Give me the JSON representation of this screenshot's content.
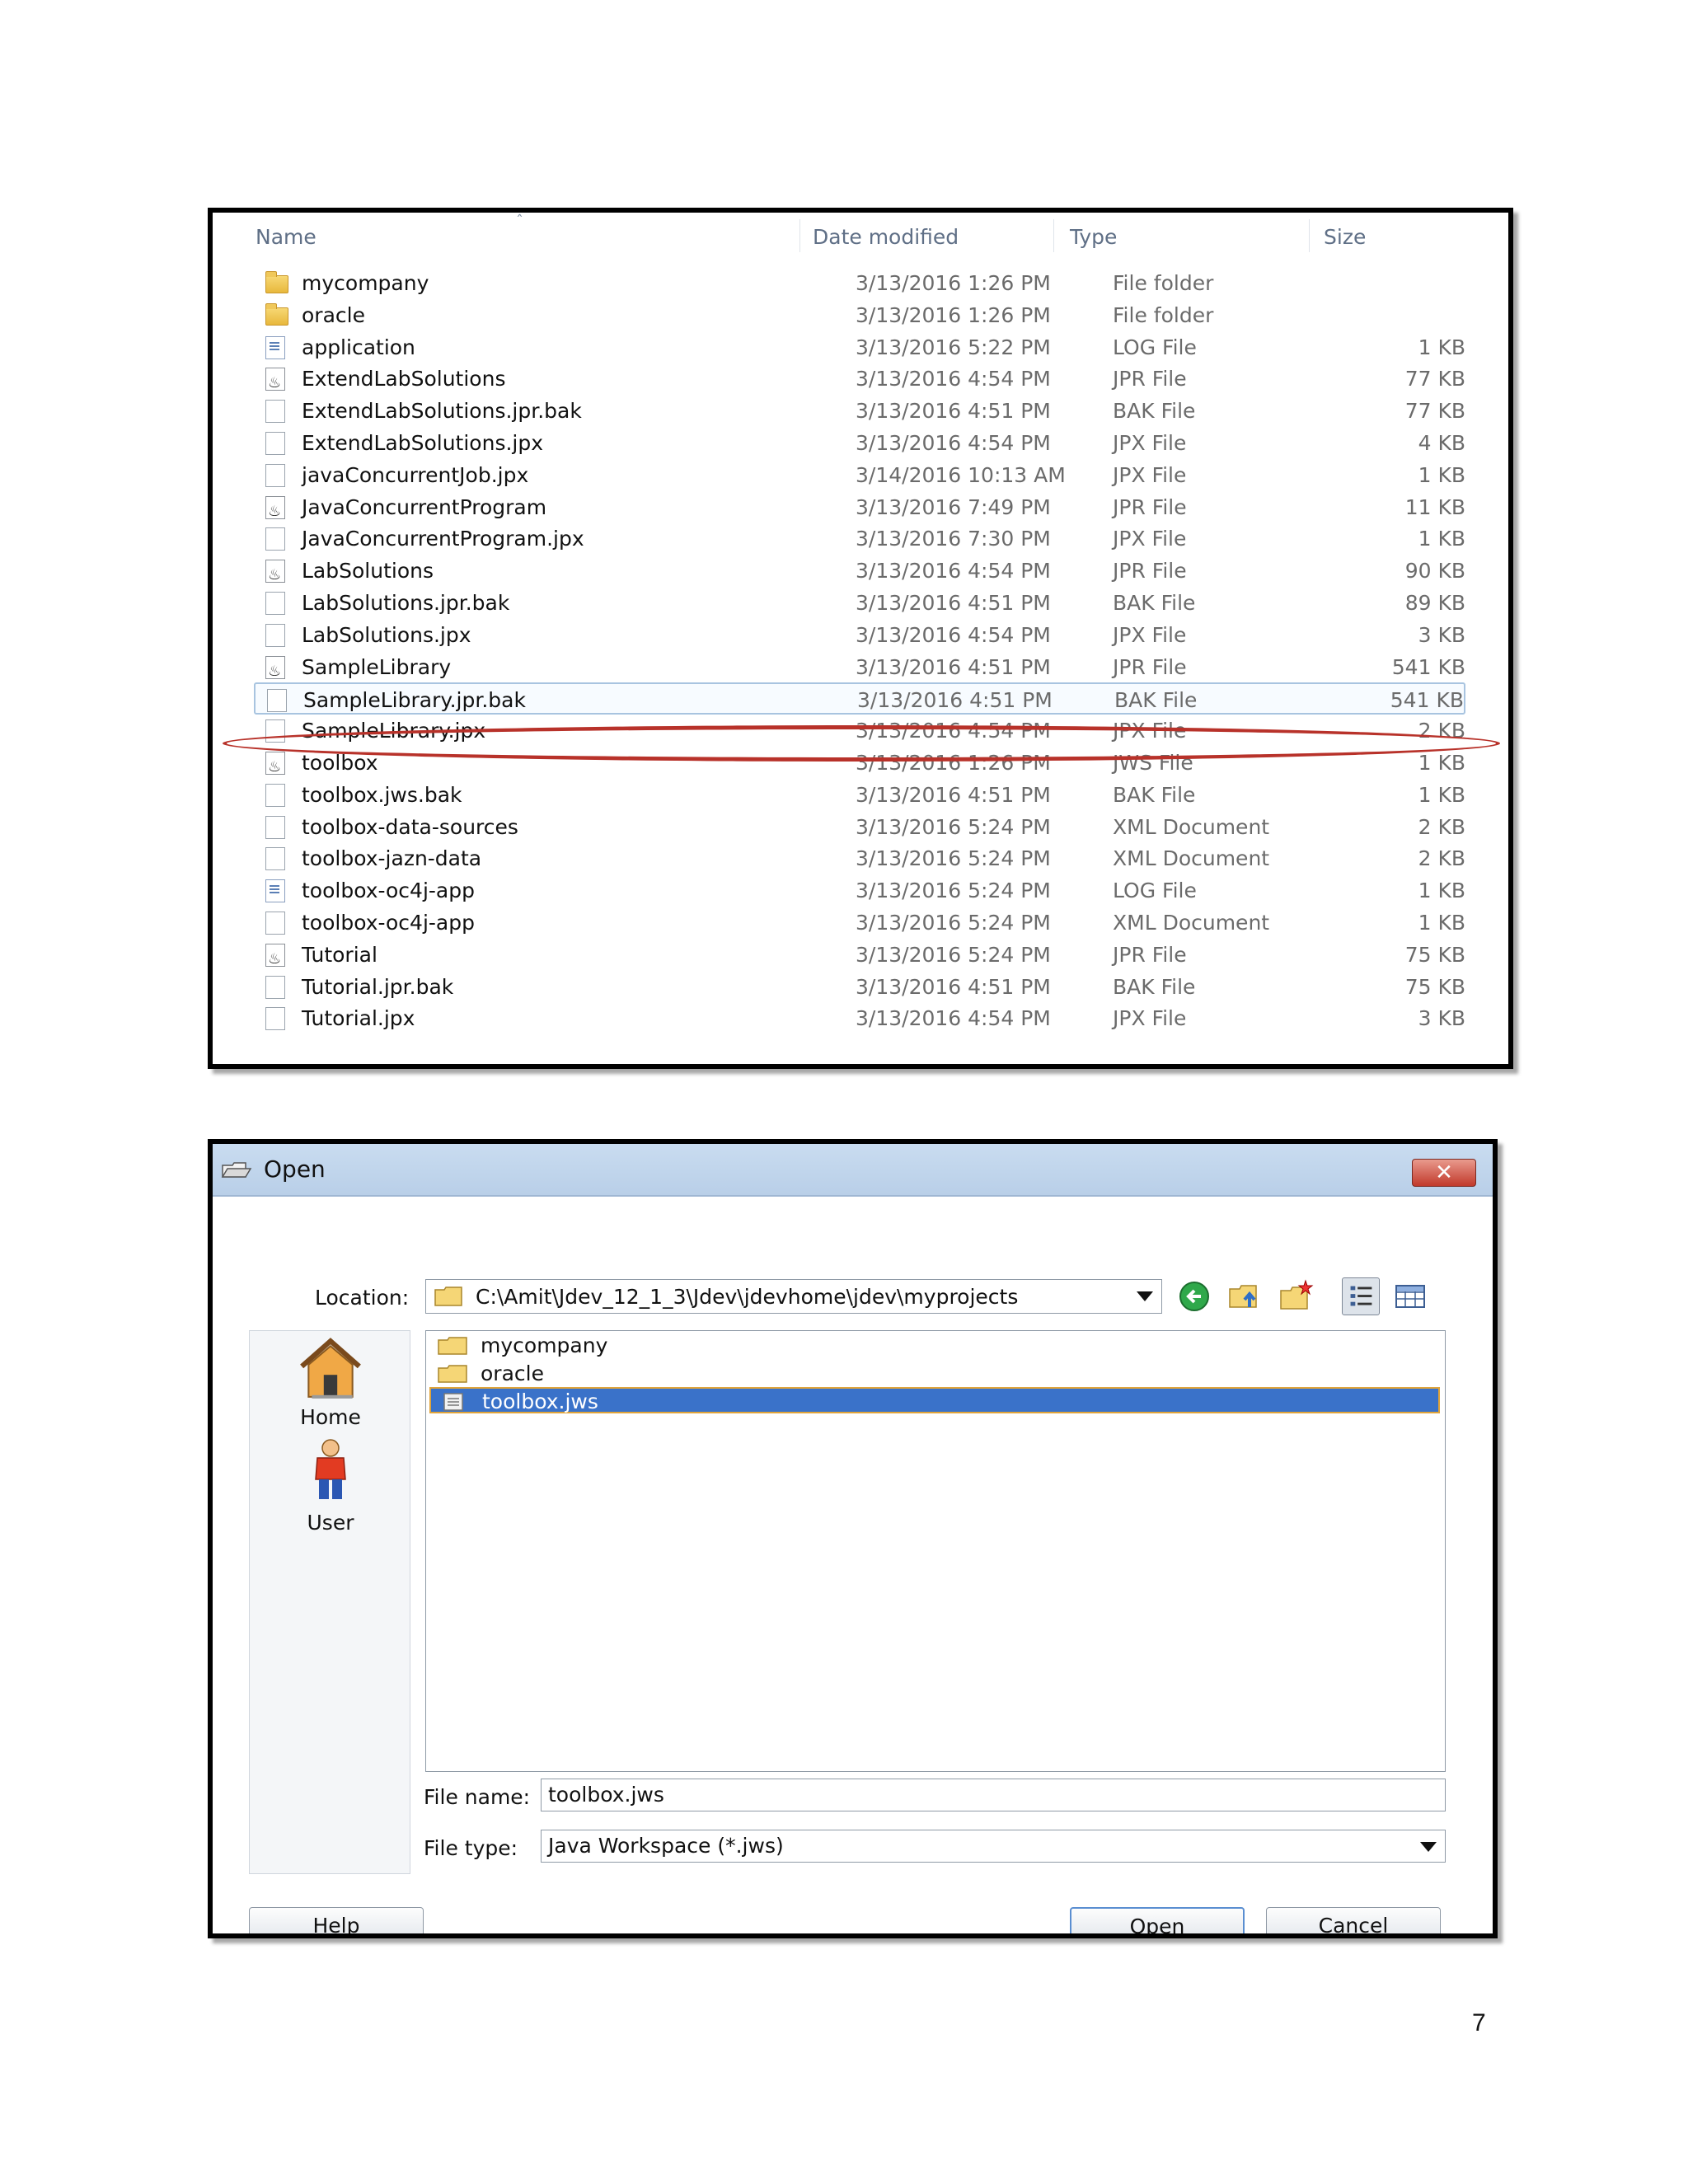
{
  "explorer": {
    "columns": {
      "name": "Name",
      "date": "Date modified",
      "type": "Type",
      "size": "Size"
    },
    "rows": [
      {
        "icon": "folder-icon",
        "name": "mycompany",
        "date": "3/13/2016 1:26 PM",
        "type": "File folder",
        "size": ""
      },
      {
        "icon": "folder-icon",
        "name": "oracle",
        "date": "3/13/2016 1:26 PM",
        "type": "File folder",
        "size": ""
      },
      {
        "icon": "log-file-icon",
        "name": "application",
        "date": "3/13/2016 5:22 PM",
        "type": "LOG File",
        "size": "1 KB"
      },
      {
        "icon": "jdev-project-icon",
        "name": "ExtendLabSolutions",
        "date": "3/13/2016 4:54 PM",
        "type": "JPR File",
        "size": "77 KB"
      },
      {
        "icon": "file-icon",
        "name": "ExtendLabSolutions.jpr.bak",
        "date": "3/13/2016 4:51 PM",
        "type": "BAK File",
        "size": "77 KB"
      },
      {
        "icon": "file-icon",
        "name": "ExtendLabSolutions.jpx",
        "date": "3/13/2016 4:54 PM",
        "type": "JPX File",
        "size": "4 KB"
      },
      {
        "icon": "file-icon",
        "name": "javaConcurrentJob.jpx",
        "date": "3/14/2016 10:13 AM",
        "type": "JPX File",
        "size": "1 KB"
      },
      {
        "icon": "jdev-project-icon",
        "name": "JavaConcurrentProgram",
        "date": "3/13/2016 7:49 PM",
        "type": "JPR File",
        "size": "11 KB"
      },
      {
        "icon": "file-icon",
        "name": "JavaConcurrentProgram.jpx",
        "date": "3/13/2016 7:30 PM",
        "type": "JPX File",
        "size": "1 KB"
      },
      {
        "icon": "jdev-project-icon",
        "name": "LabSolutions",
        "date": "3/13/2016 4:54 PM",
        "type": "JPR File",
        "size": "90 KB"
      },
      {
        "icon": "file-icon",
        "name": "LabSolutions.jpr.bak",
        "date": "3/13/2016 4:51 PM",
        "type": "BAK File",
        "size": "89 KB"
      },
      {
        "icon": "file-icon",
        "name": "LabSolutions.jpx",
        "date": "3/13/2016 4:54 PM",
        "type": "JPX File",
        "size": "3 KB"
      },
      {
        "icon": "jdev-project-icon",
        "name": "SampleLibrary",
        "date": "3/13/2016 4:51 PM",
        "type": "JPR File",
        "size": "541 KB"
      },
      {
        "icon": "file-icon",
        "name": "SampleLibrary.jpr.bak",
        "date": "3/13/2016 4:51 PM",
        "type": "BAK File",
        "size": "541 KB",
        "selected": true
      },
      {
        "icon": "file-icon",
        "name": "SampleLibrary.jpx",
        "date": "3/13/2016 4:54 PM",
        "type": "JPX File",
        "size": "2 KB"
      },
      {
        "icon": "jdev-project-icon",
        "name": "toolbox",
        "date": "3/13/2016 1:26 PM",
        "type": "JWS File",
        "size": "1 KB",
        "highlighted": true
      },
      {
        "icon": "file-icon",
        "name": "toolbox.jws.bak",
        "date": "3/13/2016 4:51 PM",
        "type": "BAK File",
        "size": "1 KB"
      },
      {
        "icon": "file-icon",
        "name": "toolbox-data-sources",
        "date": "3/13/2016 5:24 PM",
        "type": "XML Document",
        "size": "2 KB"
      },
      {
        "icon": "file-icon",
        "name": "toolbox-jazn-data",
        "date": "3/13/2016 5:24 PM",
        "type": "XML Document",
        "size": "2 KB"
      },
      {
        "icon": "log-file-icon",
        "name": "toolbox-oc4j-app",
        "date": "3/13/2016 5:24 PM",
        "type": "LOG File",
        "size": "1 KB"
      },
      {
        "icon": "file-icon",
        "name": "toolbox-oc4j-app",
        "date": "3/13/2016 5:24 PM",
        "type": "XML Document",
        "size": "1 KB"
      },
      {
        "icon": "jdev-project-icon",
        "name": "Tutorial",
        "date": "3/13/2016 5:24 PM",
        "type": "JPR File",
        "size": "75 KB"
      },
      {
        "icon": "file-icon",
        "name": "Tutorial.jpr.bak",
        "date": "3/13/2016 4:51 PM",
        "type": "BAK File",
        "size": "75 KB"
      },
      {
        "icon": "file-icon",
        "name": "Tutorial.jpx",
        "date": "3/13/2016 4:54 PM",
        "type": "JPX File",
        "size": "3 KB"
      }
    ],
    "highlight_color": "#b8322a"
  },
  "dialog": {
    "title": "Open",
    "close_glyph": "✕",
    "location_label": "Location:",
    "location_value": "C:\\Amit\\Jdev_12_1_3\\Jdev\\jdevhome\\jdev\\myprojects",
    "places": [
      {
        "label": "Home",
        "icon": "home-icon"
      },
      {
        "label": "User",
        "icon": "user-icon"
      }
    ],
    "files": [
      {
        "name": "mycompany",
        "icon": "folder-icon"
      },
      {
        "name": "oracle",
        "icon": "folder-icon"
      },
      {
        "name": "toolbox.jws",
        "icon": "workspace-file-icon",
        "selected": true
      }
    ],
    "file_name_label": "File name:",
    "file_name_value": "toolbox.jws",
    "file_type_label": "File type:",
    "file_type_value": "Java Workspace (*.jws)",
    "buttons": {
      "help": "Help",
      "open": "Open",
      "cancel": "Cancel"
    },
    "selection_color": "#3a72c9"
  },
  "page_number": "7"
}
